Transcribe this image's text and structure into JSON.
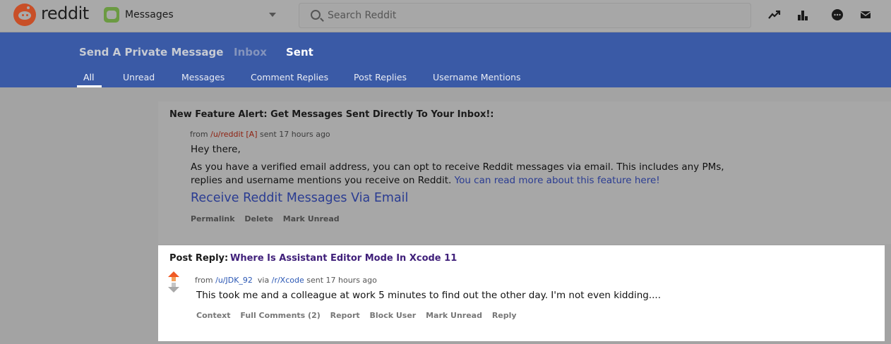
{
  "header": {
    "brand": "reddit",
    "community": "Messages",
    "search_placeholder": "Search Reddit",
    "icons": [
      "trending-icon",
      "leaderboard-icon",
      "chat-icon",
      "mail-icon"
    ]
  },
  "message_nav": {
    "main_tabs": [
      {
        "label": "Send A Private Message",
        "state": "normal"
      },
      {
        "label": "Inbox",
        "state": "dimmed"
      },
      {
        "label": "Sent",
        "state": "active"
      }
    ],
    "filter_tabs": [
      "All",
      "Unread",
      "Messages",
      "Comment Replies",
      "Post Replies",
      "Username Mentions"
    ],
    "active_filter": "All"
  },
  "messages": [
    {
      "title": "New Feature Alert: Get Messages Sent Directly To Your Inbox!:",
      "from_prefix": "from",
      "user": "/u/reddit",
      "badge": "[A]",
      "time": "sent 17 hours ago",
      "greeting": "Hey there,",
      "body": "As you have a verified email address, you can opt to receive Reddit messages via email. This includes any PMs, replies and username mentions you receive on Reddit.",
      "body_link": "You can read more about this feature here!",
      "cta": "Receive Reddit Messages Via Email",
      "actions": [
        "Permalink",
        "Delete",
        "Mark Unread"
      ]
    },
    {
      "label": "Post Reply:",
      "post_title": "Where Is Assistant Editor Mode In Xcode 11",
      "from_prefix": "from",
      "user": "/u/JDK_92",
      "via": "via",
      "subreddit": "/r/Xcode",
      "time": "sent 17 hours ago",
      "body": "This took me and a colleague at work 5 minutes to find out the other day. I'm not even kidding....",
      "actions": [
        "Context",
        "Full Comments (2)",
        "Report",
        "Block User",
        "Mark Unread",
        "Reply"
      ]
    }
  ],
  "colors": {
    "brand": "#c84f28",
    "nav_blue": "#3a5aa6",
    "upvote": "#f05a24"
  }
}
